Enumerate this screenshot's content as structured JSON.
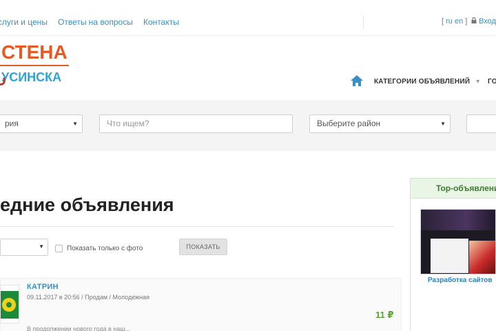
{
  "topnav": {
    "items": [
      "Услуги и цены",
      "Ответы на вопросы",
      "Контакты"
    ],
    "lang_open": "[",
    "lang_ru": "ru",
    "lang_en": "en",
    "lang_close": "]",
    "login": "Вход"
  },
  "logo": {
    "line1": "СТЕНА",
    "line2": "УСИНСКА"
  },
  "mainnav": {
    "categories": "КАТЕГОРИИ ОБЪЯВЛЕНИЙ",
    "next": "ГО"
  },
  "search": {
    "category_value": "рия",
    "query_placeholder": "Что ищем?",
    "district_value": "Выберите район"
  },
  "main": {
    "heading": "едние объявления",
    "show_photo_label": "Показать только с фото",
    "show_button": "ПОКАЗАТЬ"
  },
  "listing": {
    "title": "КАТРИН",
    "meta": "09.11.2017 в 20:56 / Продам / Молодежная",
    "price": "11 ₽",
    "desc": "В продолжении нового года в наш..."
  },
  "topads": {
    "heading": "Top-объявлени",
    "caption": "Разработка сайтов"
  },
  "colors": {
    "accent_blue": "#3a8fc4",
    "logo_orange": "#e55a23",
    "logo_blue": "#2ea4d7",
    "price_green": "#5aa33b"
  }
}
